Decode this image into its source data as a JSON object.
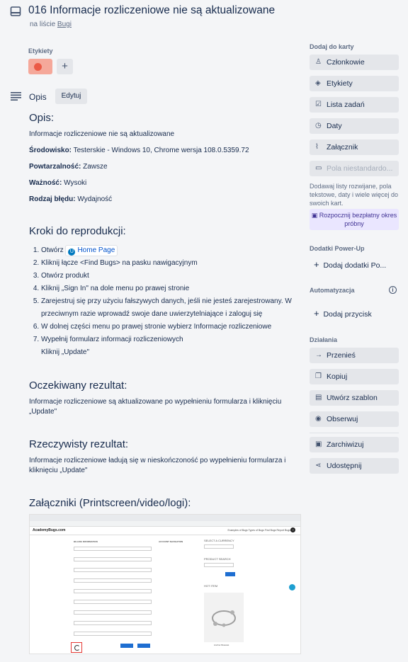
{
  "card": {
    "title": "016 Informacje rozliczeniowe nie są aktualizowane",
    "list_prefix": "na liście",
    "list_name": "Bugi"
  },
  "labels": {
    "heading": "Etykiety",
    "chip_color": "#eb5a46",
    "add_icon": "+"
  },
  "description": {
    "heading": "Opis",
    "edit_label": "Edytuj",
    "opis_heading": "Opis:",
    "summary": "Informacje rozliczeniowe nie są aktualizowane",
    "env_label": "Środowisko:",
    "env_value": " Testerskie - Windows 10, Chrome wersja 108.0.5359.72",
    "repeat_label": "Powtarzalność:",
    "repeat_value": " Zawsze",
    "prio_label": "Ważność:",
    "prio_value": " Wysoki",
    "type_label": "Rodzaj błędu:",
    "type_value": " Wydajność",
    "steps_heading": "Kroki do reprodukcji:",
    "steps": [
      "Otwórz ",
      "Kliknij łącze <Find Bugs> na pasku nawigacyjnym",
      "Otwórz produkt",
      "Kliknij „Sign In\" na dole menu po prawej stronie",
      "Zarejestruj się przy użyciu fałszywych danych, jeśli nie jesteś zarejestrowany. W przeciwnym razie wprowadź swoje dane uwierzytelniające i zaloguj się",
      "W dolnej części menu po prawej stronie wybierz Informacje rozliczeniowe",
      "Wypełnij formularz informacji rozliczeniowych"
    ],
    "step_link": "Home Page",
    "step_extra": "Kliknij „Update\"",
    "expected_heading": "Oczekiwany rezultat:",
    "expected_text": "Informacje rozliczeniowe są aktualizowane po wypełnieniu formularza i kliknięciu „Update\"",
    "actual_heading": "Rzeczywisty rezultat:",
    "actual_text": "Informacje rozliczeniowe ładują się w nieskończoność po wypełnieniu formularza i kliknięciu „Update\"",
    "attach_heading": "Załączniki (Printscreen/video/logi):"
  },
  "screenshot": {
    "logo": "AcademyBugs.com",
    "nav": "Examples of Bugs   Types of Bugs   Find Bugs   Report Bugs",
    "billing": "BILLING INFORMATION",
    "account_nav": "ACCOUNT NAVIGATION",
    "currency": "SELECT A CURRENCY",
    "product_search": "PRODUCT SEARCH",
    "hot_item": "HOT ITEM",
    "product_name": "Anchor Bracelet"
  },
  "sidebar": {
    "add_to_card": "Dodaj do karty",
    "buttons": [
      {
        "icon": "person-icon",
        "glyph": "♙",
        "label": "Członkowie"
      },
      {
        "icon": "tag-icon",
        "glyph": "◈",
        "label": "Etykiety"
      },
      {
        "icon": "checklist-icon",
        "glyph": "☑",
        "label": "Lista zadań"
      },
      {
        "icon": "clock-icon",
        "glyph": "◷",
        "label": "Daty"
      },
      {
        "icon": "paperclip-icon",
        "glyph": "⌇",
        "label": "Załącznik"
      },
      {
        "icon": "custom-fields-icon",
        "glyph": "▭",
        "label": "Pola niestandardo..."
      }
    ],
    "custom_note": "Dodawaj listy rozwijane, pola tekstowe, daty i wiele więcej do swoich kart.",
    "trial_label": "Rozpocznij bezpłatny okres próbny",
    "powerups_heading": "Dodatki Power-Up",
    "add_powerup": "Dodaj dodatki Po...",
    "automation_heading": "Automatyzacja",
    "add_button": "Dodaj przycisk",
    "actions_heading": "Działania",
    "actions": [
      {
        "icon": "arrow-right-icon",
        "glyph": "→",
        "label": "Przenieś"
      },
      {
        "icon": "copy-icon",
        "glyph": "❐",
        "label": "Kopiuj"
      },
      {
        "icon": "template-icon",
        "glyph": "▤",
        "label": "Utwórz szablon"
      },
      {
        "icon": "eye-icon",
        "glyph": "◉",
        "label": "Obserwuj"
      }
    ],
    "archive": {
      "icon": "archive-icon",
      "glyph": "▣",
      "label": "Zarchiwizuj"
    },
    "share": {
      "icon": "share-icon",
      "glyph": "⋖",
      "label": "Udostępnij"
    }
  }
}
